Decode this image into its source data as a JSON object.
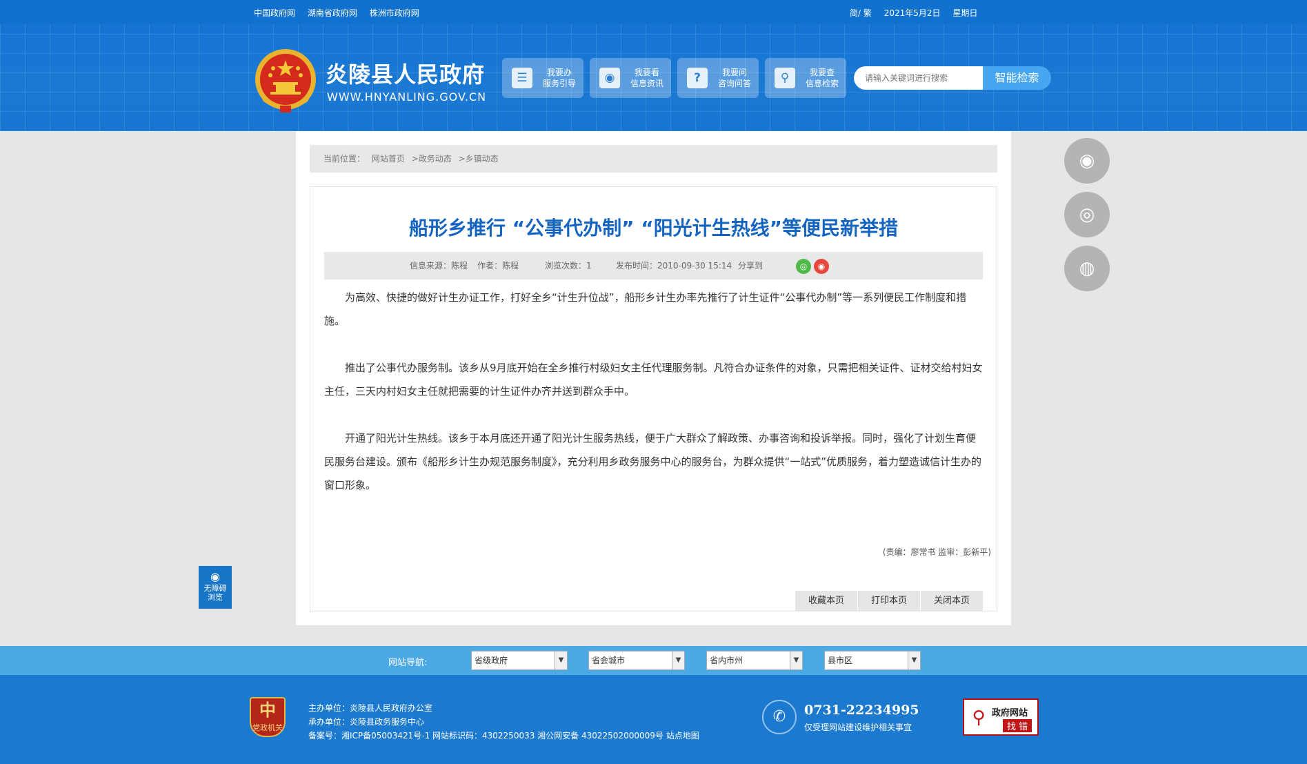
{
  "topbar": {
    "links": [
      "中国政府网",
      "湖南省政府网",
      "株洲市政府网"
    ],
    "lang": "简/ 繁",
    "date": "2021年5月2日",
    "weekday": "星期日"
  },
  "header": {
    "site_name": "炎陵县人民政府",
    "domain": "WWW.HNYANLING.GOV.CN",
    "nav": [
      {
        "line1": "我要办",
        "line2": "服务引导",
        "icon": "document-icon"
      },
      {
        "line1": "我要看",
        "line2": "信息资讯",
        "icon": "eye-icon"
      },
      {
        "line1": "我要问",
        "line2": "咨询问答",
        "icon": "question-icon"
      },
      {
        "line1": "我要查",
        "line2": "信息检索",
        "icon": "search-icon"
      }
    ],
    "search_placeholder": "请输入关键词进行搜索",
    "search_button": "智能检索"
  },
  "breadcrumb": {
    "label": "当前位置：",
    "items": [
      "网站首页",
      ">政务动态",
      ">乡镇动态"
    ]
  },
  "article": {
    "title": "船形乡推行 “公事代办制” “阳光计生热线”等便民新举措",
    "meta": {
      "source": "信息来源：陈程",
      "author": "作者：陈程",
      "views": "浏览次数：1",
      "published": "发布时间：2010-09-30 15:14",
      "share": "分享到"
    },
    "paragraphs": [
      "为高效、快捷的做好计生办证工作，打好全乡“计生升位战”，船形乡计生办率先推行了计生证件“公事代办制”等一系列便民工作制度和措施。",
      "推出了公事代办服务制。该乡从9月底开始在全乡推行村级妇女主任代理服务制。凡符合办证条件的对象，只需把相关证件、证材交给村妇女主任，三天内村妇女主任就把需要的计生证件办齐并送到群众手中。",
      "开通了阳光计生热线。该乡于本月底还开通了阳光计生服务热线，便于广大群众了解政策、办事咨询和投诉举报。同时，强化了计划生育便民服务台建设。颁布《船形乡计生办规范服务制度》，充分利用乡政务服务中心的服务台，为群众提供“一站式”优质服务，着力塑造诚信计生办的窗口形象。"
    ],
    "editor": "(责编：廖常书    监审：彭新平)",
    "actions": [
      "收藏本页",
      "打印本页",
      "关闭本页"
    ]
  },
  "accessibility": {
    "line1": "无障碍",
    "line2": "浏览"
  },
  "footer_nav": {
    "label": "网站导航:",
    "selects": [
      "省级政府",
      "省会城市",
      "省内市州",
      "县市区"
    ]
  },
  "footer": {
    "party_logo_text": "党政机关",
    "host": "主办单位：炎陵县人民政府办公室",
    "undertaker": "承办单位：炎陵县政务服务中心",
    "record": "备案号：湘ICP备05003421号-1 网站标识码：4302250033 湘公网安备 43022502000009号 站点地图",
    "phone": "0731-22234995",
    "phone_note": "仅受理网站建设维护相关事宜",
    "badge_line1": "政府网站",
    "badge_line2": "找 错"
  },
  "colors": {
    "brand_blue": "#1071cf",
    "title_blue": "#1565c0",
    "footer_nav": "#4ba9e6",
    "float_gray": "#b4b4b4"
  }
}
